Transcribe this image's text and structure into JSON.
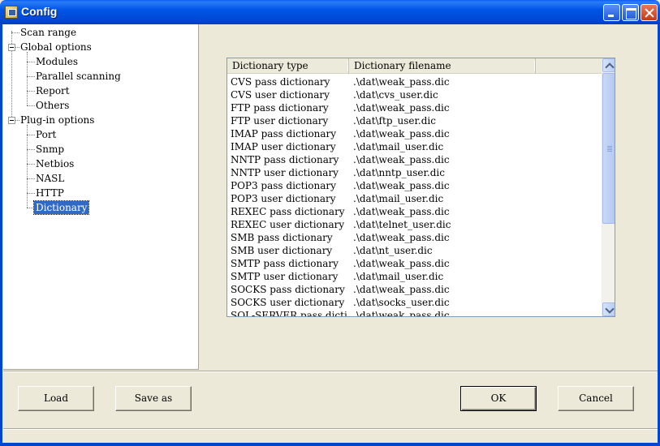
{
  "window": {
    "title": "Config",
    "icon": "config-app-icon"
  },
  "tree": {
    "items": [
      {
        "label": "Scan range"
      },
      {
        "label": "Global options"
      },
      {
        "label": "Modules"
      },
      {
        "label": "Parallel scanning"
      },
      {
        "label": "Report"
      },
      {
        "label": "Others"
      },
      {
        "label": "Plug-in options"
      },
      {
        "label": "Port"
      },
      {
        "label": "Snmp"
      },
      {
        "label": "Netbios"
      },
      {
        "label": "NASL"
      },
      {
        "label": "HTTP"
      },
      {
        "label": "Dictionary",
        "selected": true
      }
    ]
  },
  "list": {
    "columns": [
      "Dictionary type",
      "Dictionary filename"
    ],
    "rows": [
      [
        "CVS pass dictionary",
        ".\\dat\\weak_pass.dic"
      ],
      [
        "CVS user dictionary",
        ".\\dat\\cvs_user.dic"
      ],
      [
        "FTP pass dictionary",
        ".\\dat\\weak_pass.dic"
      ],
      [
        "FTP user dictionary",
        ".\\dat\\ftp_user.dic"
      ],
      [
        "IMAP pass dictionary",
        ".\\dat\\weak_pass.dic"
      ],
      [
        "IMAP user dictionary",
        ".\\dat\\mail_user.dic"
      ],
      [
        "NNTP pass dictionary",
        ".\\dat\\weak_pass.dic"
      ],
      [
        "NNTP user dictionary",
        ".\\dat\\nntp_user.dic"
      ],
      [
        "POP3 pass dictionary",
        ".\\dat\\weak_pass.dic"
      ],
      [
        "POP3 user dictionary",
        ".\\dat\\mail_user.dic"
      ],
      [
        "REXEC pass dictionary",
        ".\\dat\\weak_pass.dic"
      ],
      [
        "REXEC user dictionary",
        ".\\dat\\telnet_user.dic"
      ],
      [
        "SMB pass dictionary",
        ".\\dat\\weak_pass.dic"
      ],
      [
        "SMB user dictionary",
        ".\\dat\\nt_user.dic"
      ],
      [
        "SMTP pass dictionary",
        ".\\dat\\weak_pass.dic"
      ],
      [
        "SMTP user dictionary",
        ".\\dat\\mail_user.dic"
      ],
      [
        "SOCKS pass dictionary",
        ".\\dat\\weak_pass.dic"
      ],
      [
        "SOCKS user dictionary",
        ".\\dat\\socks_user.dic"
      ],
      [
        "SQL-SERVER pass diction...",
        ".\\dat\\weak_pass.dic"
      ]
    ]
  },
  "buttons": {
    "load": "Load",
    "save_as": "Save as",
    "ok": "OK",
    "cancel": "Cancel"
  },
  "colors": {
    "titlebar": "#0055e5",
    "selection": "#316ac5",
    "dialog_bg": "#ece9d8"
  }
}
